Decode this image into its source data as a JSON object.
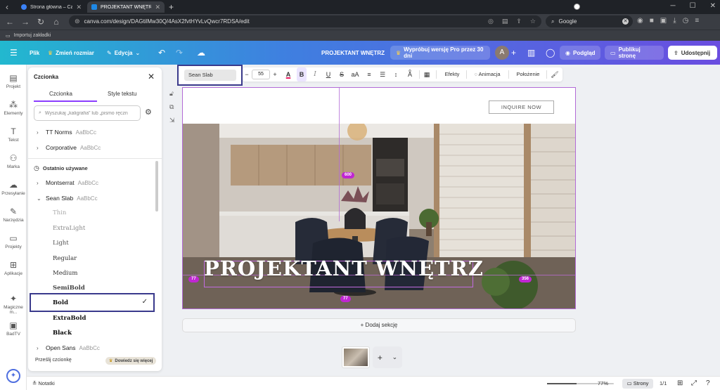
{
  "browser": {
    "tabs": [
      {
        "title": "Strona główna – Canva",
        "active": false
      },
      {
        "title": "PROJEKTANT WNĘTRZ –",
        "active": true
      }
    ],
    "url": "canva.com/design/DAGtilMw30Q/4AsX2fvtHYvLvQwcr7RDSA/edit",
    "search_engine": "Google",
    "bookmark": "Importuj zakładki"
  },
  "header": {
    "file": "Plik",
    "resize": "Zmień rozmiar",
    "edit": "Edycja",
    "doc_title": "PROJEKTANT WNĘTRZ",
    "pro_trial": "Wypróbuj wersję Pro przez 30 dni",
    "avatar_initial": "A",
    "preview": "Podgląd",
    "publish": "Publikuj stronę",
    "share": "Udostępnij",
    "gradient": [
      "#22b8cf",
      "#3f7fe0",
      "#6a4de0"
    ]
  },
  "rail": [
    {
      "label": "Projekt",
      "icon": "layout-icon"
    },
    {
      "label": "Elementy",
      "icon": "elements-icon"
    },
    {
      "label": "Tekst",
      "icon": "text-icon"
    },
    {
      "label": "Marka",
      "icon": "brand-icon"
    },
    {
      "label": "Przesyłanie",
      "icon": "upload-cloud-icon"
    },
    {
      "label": "Narzędzia",
      "icon": "tools-icon"
    },
    {
      "label": "Projekty",
      "icon": "folder-icon"
    },
    {
      "label": "Aplikacje",
      "icon": "apps-icon"
    },
    {
      "label": "Magiczne m...",
      "icon": "magic-icon"
    },
    {
      "label": "BadTV",
      "icon": "badtv-icon"
    }
  ],
  "font_panel": {
    "title": "Czcionka",
    "tabs": [
      "Czcionka",
      "Style tekstu"
    ],
    "search_placeholder": "Wyszukaj „kaligrafia” lub „pismo ręczn",
    "fonts_top": [
      {
        "name": "TT Norms",
        "sample": "AaBbCc"
      },
      {
        "name": "Corporative",
        "sample": "AaBbCc"
      }
    ],
    "recent_label": "Ostatnio używane",
    "fonts_recent": [
      {
        "name": "Montserrat",
        "sample": "AaBbCc"
      },
      {
        "name": "Sean Slab",
        "sample": "AaBbCc"
      }
    ],
    "weights": [
      "Thin",
      "ExtraLight",
      "Light",
      "Regular",
      "Medium",
      "SemiBold",
      "Bold",
      "ExtraBold",
      "Black"
    ],
    "selected_weight": "Bold",
    "font_after": {
      "name": "Open Sans",
      "sample": "AaBbCc"
    },
    "upload_fonts": "Prześlij czcionkę",
    "learn_more": "Dowiedz się więcej"
  },
  "toolbar": {
    "font_name": "Sean Slab",
    "font_size": "55",
    "bold": "B",
    "italic": "I",
    "underline": "U",
    "strike": "S",
    "case": "aA",
    "effects": "Efekty",
    "animation": "Animacja",
    "position": "Położenie"
  },
  "canvas": {
    "inquire_button": "INQUIRE NOW",
    "hero_title": "PROJEKTANT WNĘTRZ",
    "measure_top": "600",
    "measure_left": "77",
    "measure_right": "356",
    "measure_bottom": "77",
    "add_section": "Dodaj sekcję"
  },
  "bottom": {
    "notes": "Notatki",
    "zoom": "77%",
    "zoom_level": 0.44,
    "pages_button": "Strony",
    "page_count": "1/1"
  }
}
